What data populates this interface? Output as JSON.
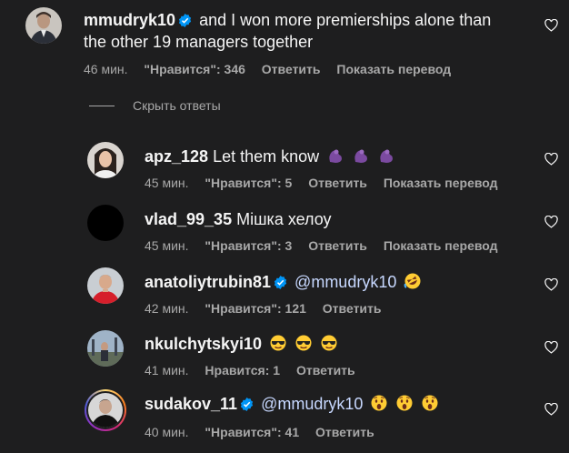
{
  "main_comment": {
    "username": "mmudryk10",
    "text": "and I won more premierships alone than the other 19 managers together",
    "time": "46 мин.",
    "likes": "\"Нравится\": 346",
    "reply": "Ответить",
    "translate": "Показать перевод"
  },
  "hide_replies": "Скрыть ответы",
  "replies": [
    {
      "username": "apz_128",
      "text": "Let them know",
      "emoji": "flexed-biceps-purple x3",
      "time": "45 мин.",
      "likes": "\"Нравится\": 5",
      "reply": "Ответить",
      "translate": "Показать перевод"
    },
    {
      "username": "vlad_99_35",
      "text": "Мішка хелоу",
      "time": "45 мин.",
      "likes": "\"Нравится\": 3",
      "reply": "Ответить",
      "translate": "Показать перевод"
    },
    {
      "username": "anatoliytrubin81",
      "mention": "@mmudryk10",
      "emoji": "rolling-on-floor-laughing",
      "time": "42 мин.",
      "likes": "\"Нравится\": 121",
      "reply": "Ответить"
    },
    {
      "username": "nkulchytskyi10",
      "emoji": "smiling-face-with-sunglasses x3",
      "time": "41 мин.",
      "likes": "Нравится: 1",
      "reply": "Ответить"
    },
    {
      "username": "sudakov_11",
      "mention": "@mmudryk10",
      "emoji": "astonished-face x3",
      "time": "40 мин.",
      "likes": "\"Нравится\": 41",
      "reply": "Ответить"
    }
  ],
  "colors": {
    "background": "#1e1e1f",
    "text": "#f5f5f5",
    "meta": "#a8a8a8",
    "verified": "#0095f6"
  },
  "icons": {
    "like": "heart-outline-icon",
    "verified": "verified-badge-icon"
  }
}
